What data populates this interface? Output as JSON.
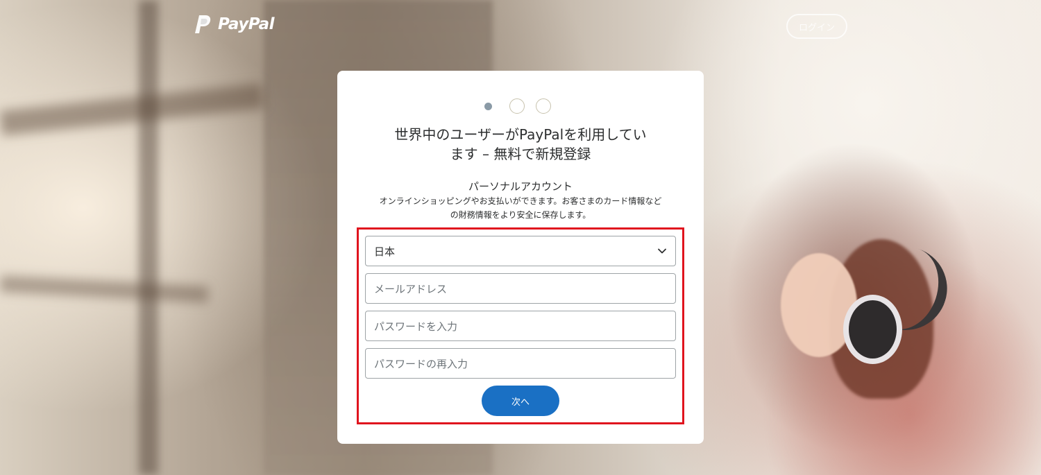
{
  "header": {
    "logo_text": "PayPal",
    "login_label": "ログイン"
  },
  "card": {
    "steps": {
      "current": 1,
      "total": 3
    },
    "title_line1": "世界中のユーザーがPayPalを利用してい",
    "title_line2": "ます – 無料で新規登録",
    "account_type": "パーソナルアカウント",
    "account_desc_line1": "オンラインショッピングやお支払いができます。お客さまのカード情報など",
    "account_desc_line2": "の財務情報をより安全に保存します。"
  },
  "form": {
    "country_value": "日本",
    "email_placeholder": "メールアドレス",
    "password_placeholder": "パスワードを入力",
    "password_confirm_placeholder": "パスワードの再入力",
    "next_label": "次へ"
  },
  "colors": {
    "primary_button": "#1a70c4",
    "highlight": "#e0141e",
    "text": "#2c2e2f"
  }
}
